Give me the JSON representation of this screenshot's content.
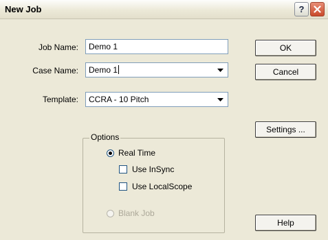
{
  "dialog": {
    "title": "New Job",
    "help_glyph": "?",
    "close_icon": "close-x-icon"
  },
  "form": {
    "job_name_label": "Job Name:",
    "job_name_value": "Demo 1",
    "case_name_label": "Case Name:",
    "case_name_value": "Demo 1",
    "template_label": "Template:",
    "template_value": "CCRA - 10 Pitch"
  },
  "options": {
    "legend": "Options",
    "real_time_label": "Real Time",
    "real_time_selected": true,
    "use_insync_label": "Use InSync",
    "use_insync_checked": false,
    "use_localscope_label": "Use LocalScope",
    "use_localscope_checked": false,
    "blank_job_label": "Blank Job",
    "blank_job_enabled": false
  },
  "buttons": {
    "ok": "OK",
    "cancel": "Cancel",
    "settings": "Settings ...",
    "help": "Help"
  },
  "colors": {
    "dialog_bg": "#ece9d8",
    "close_button": "#c94a2b",
    "field_border": "#7f9db9"
  }
}
